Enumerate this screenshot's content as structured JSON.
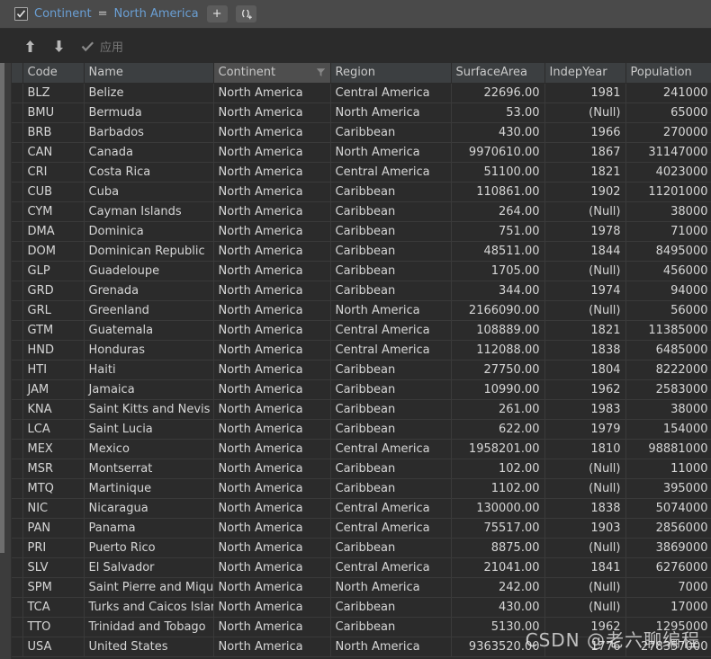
{
  "filter_bar": {
    "checkbox_checked": true,
    "field": "Continent",
    "operator": "=",
    "value": "North America",
    "add_button": "+",
    "add_group_button": "()₊"
  },
  "apply_bar": {
    "move_up_icon": "arrow-up-icon",
    "move_down_icon": "arrow-down-icon",
    "apply_icon": "check-icon",
    "apply_label": "应用"
  },
  "table": {
    "active_column": "Continent",
    "filter_icon": "funnel-icon",
    "columns": [
      "Code",
      "Name",
      "Continent",
      "Region",
      "SurfaceArea",
      "IndepYear",
      "Population"
    ],
    "rows": [
      [
        "BLZ",
        "Belize",
        "North America",
        "Central America",
        "22696.00",
        "1981",
        "241000"
      ],
      [
        "BMU",
        "Bermuda",
        "North America",
        "North America",
        "53.00",
        "(Null)",
        "65000"
      ],
      [
        "BRB",
        "Barbados",
        "North America",
        "Caribbean",
        "430.00",
        "1966",
        "270000"
      ],
      [
        "CAN",
        "Canada",
        "North America",
        "North America",
        "9970610.00",
        "1867",
        "31147000"
      ],
      [
        "CRI",
        "Costa Rica",
        "North America",
        "Central America",
        "51100.00",
        "1821",
        "4023000"
      ],
      [
        "CUB",
        "Cuba",
        "North America",
        "Caribbean",
        "110861.00",
        "1902",
        "11201000"
      ],
      [
        "CYM",
        "Cayman Islands",
        "North America",
        "Caribbean",
        "264.00",
        "(Null)",
        "38000"
      ],
      [
        "DMA",
        "Dominica",
        "North America",
        "Caribbean",
        "751.00",
        "1978",
        "71000"
      ],
      [
        "DOM",
        "Dominican Republic",
        "North America",
        "Caribbean",
        "48511.00",
        "1844",
        "8495000"
      ],
      [
        "GLP",
        "Guadeloupe",
        "North America",
        "Caribbean",
        "1705.00",
        "(Null)",
        "456000"
      ],
      [
        "GRD",
        "Grenada",
        "North America",
        "Caribbean",
        "344.00",
        "1974",
        "94000"
      ],
      [
        "GRL",
        "Greenland",
        "North America",
        "North America",
        "2166090.00",
        "(Null)",
        "56000"
      ],
      [
        "GTM",
        "Guatemala",
        "North America",
        "Central America",
        "108889.00",
        "1821",
        "11385000"
      ],
      [
        "HND",
        "Honduras",
        "North America",
        "Central America",
        "112088.00",
        "1838",
        "6485000"
      ],
      [
        "HTI",
        "Haiti",
        "North America",
        "Caribbean",
        "27750.00",
        "1804",
        "8222000"
      ],
      [
        "JAM",
        "Jamaica",
        "North America",
        "Caribbean",
        "10990.00",
        "1962",
        "2583000"
      ],
      [
        "KNA",
        "Saint Kitts and Nevis",
        "North America",
        "Caribbean",
        "261.00",
        "1983",
        "38000"
      ],
      [
        "LCA",
        "Saint Lucia",
        "North America",
        "Caribbean",
        "622.00",
        "1979",
        "154000"
      ],
      [
        "MEX",
        "Mexico",
        "North America",
        "Central America",
        "1958201.00",
        "1810",
        "98881000"
      ],
      [
        "MSR",
        "Montserrat",
        "North America",
        "Caribbean",
        "102.00",
        "(Null)",
        "11000"
      ],
      [
        "MTQ",
        "Martinique",
        "North America",
        "Caribbean",
        "1102.00",
        "(Null)",
        "395000"
      ],
      [
        "NIC",
        "Nicaragua",
        "North America",
        "Central America",
        "130000.00",
        "1838",
        "5074000"
      ],
      [
        "PAN",
        "Panama",
        "North America",
        "Central America",
        "75517.00",
        "1903",
        "2856000"
      ],
      [
        "PRI",
        "Puerto Rico",
        "North America",
        "Caribbean",
        "8875.00",
        "(Null)",
        "3869000"
      ],
      [
        "SLV",
        "El Salvador",
        "North America",
        "Central America",
        "21041.00",
        "1841",
        "6276000"
      ],
      [
        "SPM",
        "Saint Pierre and Miquelon",
        "North America",
        "North America",
        "242.00",
        "(Null)",
        "7000"
      ],
      [
        "TCA",
        "Turks and Caicos Islands",
        "North America",
        "Caribbean",
        "430.00",
        "(Null)",
        "17000"
      ],
      [
        "TTO",
        "Trinidad and Tobago",
        "North America",
        "Caribbean",
        "5130.00",
        "1962",
        "1295000"
      ],
      [
        "USA",
        "United States",
        "North America",
        "North America",
        "9363520.00",
        "1776",
        "278357000"
      ]
    ],
    "null_token": "(Null)",
    "numeric_columns": [
      4,
      5,
      6
    ]
  },
  "watermark": {
    "text": "CSDN @老六聊编程"
  },
  "colors": {
    "background": "#2b2b2b",
    "filter_bar_bg": "#4a4a4a",
    "header_bg": "#3c3f41",
    "active_header_bg": "#4e4e4e",
    "link": "#6a9fd4",
    "text": "#d6d6d6",
    "null_text": "#7a7a7a"
  }
}
